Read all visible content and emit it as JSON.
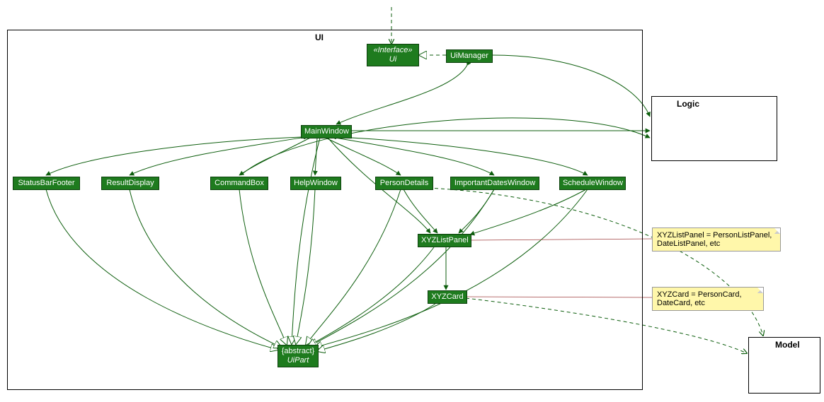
{
  "diagram": {
    "packages": {
      "ui": {
        "title": "UI"
      },
      "logic": {
        "title": "Logic"
      },
      "model": {
        "title": "Model"
      }
    },
    "nodes": {
      "ui_interface": {
        "stereotype": "«Interface»",
        "name": "Ui"
      },
      "ui_manager": {
        "name": "UiManager"
      },
      "main_window": {
        "name": "MainWindow"
      },
      "status_bar_footer": {
        "name": "StatusBarFooter"
      },
      "result_display": {
        "name": "ResultDisplay"
      },
      "command_box": {
        "name": "CommandBox"
      },
      "help_window": {
        "name": "HelpWindow"
      },
      "person_details": {
        "name": "PersonDetails"
      },
      "important_dates_window": {
        "name": "ImportantDatesWindow"
      },
      "schedule_window": {
        "name": "ScheduleWindow"
      },
      "xyz_list_panel": {
        "name": "XYZListPanel"
      },
      "xyz_card": {
        "name": "XYZCard"
      },
      "ui_part": {
        "stereotype": "{abstract}",
        "name": "UiPart"
      }
    },
    "notes": {
      "xyz_list_panel_note": "XYZListPanel = PersonListPanel, DateListPanel, etc",
      "xyz_card_note": "XYZCard = PersonCard, DateCard, etc"
    },
    "relationships": [
      {
        "type": "dependency-external-in",
        "from": "external",
        "to": "ui_interface"
      },
      {
        "type": "realization",
        "from": "ui_manager",
        "to": "ui_interface"
      },
      {
        "type": "composition",
        "from": "ui_manager",
        "to": "main_window"
      },
      {
        "type": "association",
        "from": "ui_manager",
        "to": "logic"
      },
      {
        "type": "association",
        "from": "main_window",
        "to": "logic"
      },
      {
        "type": "composition",
        "from": "main_window",
        "to": "status_bar_footer"
      },
      {
        "type": "composition",
        "from": "main_window",
        "to": "result_display"
      },
      {
        "type": "composition",
        "from": "main_window",
        "to": "command_box"
      },
      {
        "type": "composition",
        "from": "main_window",
        "to": "help_window"
      },
      {
        "type": "composition",
        "from": "main_window",
        "to": "person_details"
      },
      {
        "type": "composition",
        "from": "main_window",
        "to": "important_dates_window"
      },
      {
        "type": "composition",
        "from": "main_window",
        "to": "schedule_window"
      },
      {
        "type": "composition",
        "from": "main_window",
        "to": "xyz_list_panel"
      },
      {
        "type": "composition",
        "from": "person_details",
        "to": "xyz_list_panel"
      },
      {
        "type": "composition",
        "from": "important_dates_window",
        "to": "xyz_list_panel"
      },
      {
        "type": "composition",
        "from": "schedule_window",
        "to": "xyz_list_panel"
      },
      {
        "type": "composition",
        "from": "xyz_list_panel",
        "to": "xyz_card"
      },
      {
        "type": "generalization",
        "from": "main_window",
        "to": "ui_part"
      },
      {
        "type": "generalization",
        "from": "status_bar_footer",
        "to": "ui_part"
      },
      {
        "type": "generalization",
        "from": "result_display",
        "to": "ui_part"
      },
      {
        "type": "generalization",
        "from": "command_box",
        "to": "ui_part"
      },
      {
        "type": "generalization",
        "from": "help_window",
        "to": "ui_part"
      },
      {
        "type": "generalization",
        "from": "person_details",
        "to": "ui_part"
      },
      {
        "type": "generalization",
        "from": "important_dates_window",
        "to": "ui_part"
      },
      {
        "type": "generalization",
        "from": "schedule_window",
        "to": "ui_part"
      },
      {
        "type": "generalization",
        "from": "xyz_list_panel",
        "to": "ui_part"
      },
      {
        "type": "generalization",
        "from": "xyz_card",
        "to": "ui_part"
      },
      {
        "type": "association",
        "from": "command_box",
        "to": "logic"
      },
      {
        "type": "dependency",
        "from": "person_details",
        "to": "model"
      },
      {
        "type": "dependency",
        "from": "xyz_card",
        "to": "model"
      },
      {
        "type": "note-link",
        "from": "xyz_list_panel_note",
        "to": "xyz_list_panel"
      },
      {
        "type": "note-link",
        "from": "xyz_card_note",
        "to": "xyz_card"
      }
    ],
    "arrow_types_legend": {
      "composition": "filled diamond at owner end, solid arrowhead at part end",
      "generalization": "solid line, hollow triangle at parent",
      "realization": "dashed line, hollow triangle at interface",
      "association": "solid line, open/solid arrowhead",
      "dependency": "dashed line, open arrowhead",
      "note-link": "thin solid line, no arrowhead"
    }
  }
}
